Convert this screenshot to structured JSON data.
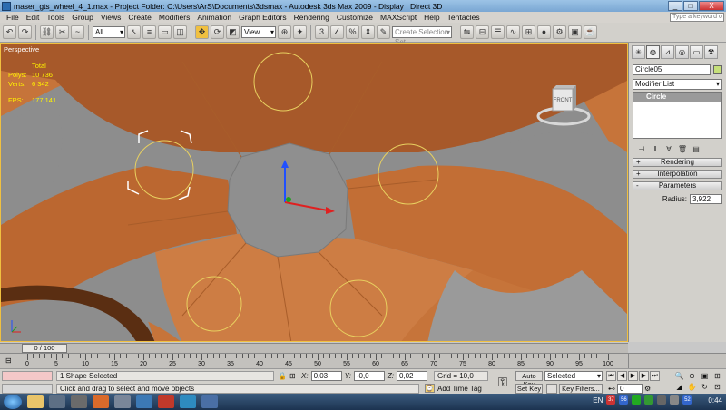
{
  "window": {
    "title": "maser_gts_wheel_4_1.max    - Project Folder: C:\\Users\\ArS\\Documents\\3dsmax    - Autodesk 3ds Max  2009      - Display : Direct 3D",
    "minimize": "_",
    "maximize": "□",
    "close": "X"
  },
  "menu": [
    "File",
    "Edit",
    "Tools",
    "Group",
    "Views",
    "Create",
    "Modifiers",
    "Animation",
    "Graph Editors",
    "Rendering",
    "Customize",
    "MAXScript",
    "Help",
    "Tentacles"
  ],
  "search_placeholder": "Type a keyword o",
  "toolbar": {
    "filter_value": "All",
    "refcoord_value": "View",
    "named_selection_placeholder": "Create Selection Set"
  },
  "viewport": {
    "label": "Perspective",
    "stats": {
      "header": "Total",
      "polys_label": "Polys:",
      "polys_value": "10 736",
      "verts_label": "Verts:",
      "verts_value": "6 342",
      "fps_label": "FPS:",
      "fps_value": "177,141"
    },
    "viewcube_face": "FRONT"
  },
  "command_panel": {
    "object_name": "Circle05",
    "object_color": "#c6e07a",
    "modifier_list": "Modifier List",
    "stack_item": "Circle",
    "rollouts": [
      {
        "sign": "+",
        "label": "Rendering"
      },
      {
        "sign": "+",
        "label": "Interpolation"
      },
      {
        "sign": "-",
        "label": "Parameters"
      }
    ],
    "radius_label": "Radius:",
    "radius_value": "3,922"
  },
  "timeline": {
    "slider_label": "0 / 100",
    "ticks": [
      "0",
      "5",
      "10",
      "15",
      "20",
      "25",
      "30",
      "35",
      "40",
      "45",
      "50",
      "55",
      "60",
      "65",
      "70",
      "75",
      "80",
      "85",
      "90",
      "95",
      "100"
    ]
  },
  "status": {
    "selection_message": "1 Shape Selected",
    "prompt": "Click and drag to select and move objects",
    "x_label": "X:",
    "x_value": "0,03",
    "y_label": "Y:",
    "y_value": "-0,0",
    "z_label": "Z:",
    "z_value": "0,02",
    "grid": "Grid = 10,0",
    "add_time_tag": "Add Time Tag",
    "auto_key": "Auto Key",
    "set_key": "Set Key",
    "selected_dropdown": "Selected",
    "key_filters": "Key Filters...",
    "frame_value": "0"
  },
  "taskbar": {
    "lang": "EN",
    "badge1": "37",
    "badge2": "56",
    "badge3": "52",
    "clock": "0:44"
  },
  "colors": {
    "mesh_orange": "#c6743a",
    "mesh_dark": "#8a4a1f",
    "viewport_bg": "#8d8d8d",
    "gizmo_yellow": "#e8d060",
    "axis_blue": "#2050ff",
    "axis_red": "#e02020",
    "axis_green": "#20a020"
  }
}
